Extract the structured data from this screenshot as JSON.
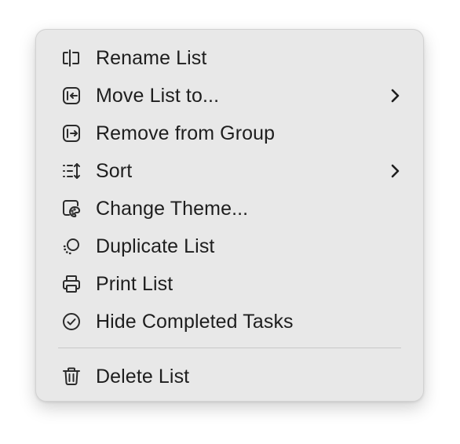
{
  "menu": {
    "items": [
      {
        "label": "Rename List",
        "icon": "rename-icon"
      },
      {
        "label": "Move List to...",
        "icon": "move-list-icon",
        "submenu": true
      },
      {
        "label": "Remove from Group",
        "icon": "remove-from-group-icon"
      },
      {
        "label": "Sort",
        "icon": "sort-icon",
        "submenu": true
      },
      {
        "label": "Change Theme...",
        "icon": "palette-icon"
      },
      {
        "label": "Duplicate List",
        "icon": "duplicate-icon"
      },
      {
        "label": "Print List",
        "icon": "printer-icon"
      },
      {
        "label": "Hide Completed Tasks",
        "icon": "checkmark-circle-icon"
      },
      {
        "label": "Delete List",
        "icon": "trash-icon"
      }
    ]
  }
}
